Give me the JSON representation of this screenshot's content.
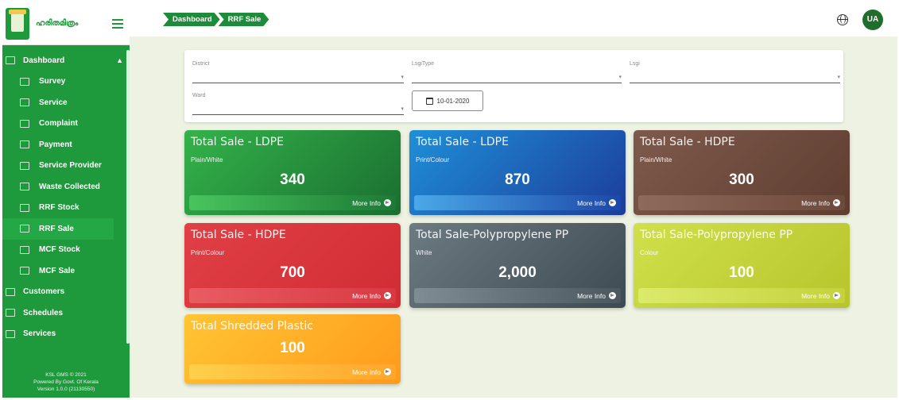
{
  "brand": {
    "name": "ഹരിതമിത്രം"
  },
  "breadcrumb": [
    "Dashboard",
    "RRF Sale"
  ],
  "topbar": {
    "avatar_initials": "UA"
  },
  "sidebar": {
    "items": [
      {
        "label": "Dashboard",
        "level": "top",
        "expanded": true
      },
      {
        "label": "Survey",
        "level": "sub"
      },
      {
        "label": "Service",
        "level": "sub"
      },
      {
        "label": "Complaint",
        "level": "sub"
      },
      {
        "label": "Payment",
        "level": "sub"
      },
      {
        "label": "Service Provider",
        "level": "sub"
      },
      {
        "label": "Waste Collected",
        "level": "sub"
      },
      {
        "label": "RRF Stock",
        "level": "sub"
      },
      {
        "label": "RRF Sale",
        "level": "sub",
        "active": true
      },
      {
        "label": "MCF Stock",
        "level": "sub"
      },
      {
        "label": "MCF Sale",
        "level": "sub"
      },
      {
        "label": "Customers",
        "level": "top"
      },
      {
        "label": "Schedules",
        "level": "top"
      },
      {
        "label": "Services",
        "level": "top"
      }
    ],
    "footer": [
      "KSL GMS © 2021",
      "Powered By Govt. Of Kerala",
      "Version 1.0.0 (21130550)"
    ]
  },
  "filters": {
    "district_label": "District",
    "lsgi_type_label": "LsgiType",
    "lsgi_label": "Lsgi",
    "ward_label": "Ward",
    "date_value": "10-01-2020"
  },
  "cards": [
    {
      "title": "Total Sale - LDPE",
      "subtitle": "Plain/White",
      "value": "340",
      "more": "More Info"
    },
    {
      "title": "Total Sale - LDPE",
      "subtitle": "Print/Colour",
      "value": "870",
      "more": "More Info"
    },
    {
      "title": "Total Sale - HDPE",
      "subtitle": "Plain/White",
      "value": "300",
      "more": "More Info"
    },
    {
      "title": "Total Sale - HDPE",
      "subtitle": "Print/Colour",
      "value": "700",
      "more": "More Info"
    },
    {
      "title": "Total Sale-Polypropylene PP",
      "subtitle": "White",
      "value": "2,000",
      "more": "More Info"
    },
    {
      "title": "Total Sale-Polypropylene PP",
      "subtitle": "Colour",
      "value": "100",
      "more": "More Info"
    },
    {
      "title": "Total Shredded Plastic",
      "subtitle": "",
      "value": "100",
      "more": "More Info"
    }
  ]
}
